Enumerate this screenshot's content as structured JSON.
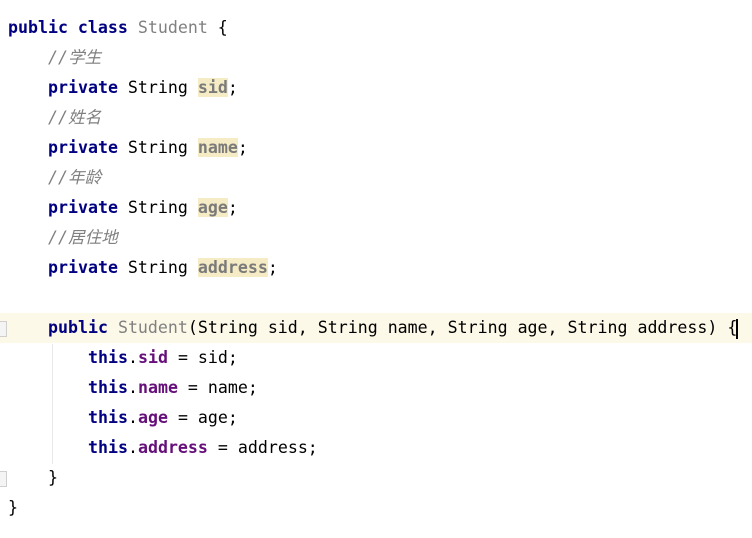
{
  "editor": {
    "language": "java",
    "current_line": 10,
    "colors": {
      "keyword": "#000080",
      "field": "#660e7a",
      "comment": "#808080",
      "unused_field_bg": "#f5ebc4",
      "current_line_bg": "#fdf9e8"
    },
    "lines": [
      {
        "indent": 0,
        "tokens": [
          {
            "t": "public class ",
            "c": "kw"
          },
          {
            "t": "Student",
            "c": "cls"
          },
          {
            "t": " {",
            "c": "plain"
          }
        ]
      },
      {
        "indent": 1,
        "tokens": [
          {
            "t": "//学生",
            "c": "cmt"
          }
        ]
      },
      {
        "indent": 1,
        "tokens": [
          {
            "t": "private",
            "c": "kw"
          },
          {
            "t": " String ",
            "c": "plain"
          },
          {
            "t": "sid",
            "c": "ufld"
          },
          {
            "t": ";",
            "c": "plain"
          }
        ]
      },
      {
        "indent": 1,
        "tokens": [
          {
            "t": "//姓名",
            "c": "cmt"
          }
        ]
      },
      {
        "indent": 1,
        "tokens": [
          {
            "t": "private",
            "c": "kw"
          },
          {
            "t": " String ",
            "c": "plain"
          },
          {
            "t": "name",
            "c": "ufld"
          },
          {
            "t": ";",
            "c": "plain"
          }
        ]
      },
      {
        "indent": 1,
        "tokens": [
          {
            "t": "//年龄",
            "c": "cmt"
          }
        ]
      },
      {
        "indent": 1,
        "tokens": [
          {
            "t": "private",
            "c": "kw"
          },
          {
            "t": " String ",
            "c": "plain"
          },
          {
            "t": "age",
            "c": "ufld"
          },
          {
            "t": ";",
            "c": "plain"
          }
        ]
      },
      {
        "indent": 1,
        "tokens": [
          {
            "t": "//居住地",
            "c": "cmt"
          }
        ]
      },
      {
        "indent": 1,
        "tokens": [
          {
            "t": "private",
            "c": "kw"
          },
          {
            "t": " String ",
            "c": "plain"
          },
          {
            "t": "address",
            "c": "ufld"
          },
          {
            "t": ";",
            "c": "plain"
          }
        ]
      },
      {
        "indent": 0,
        "tokens": []
      },
      {
        "indent": 1,
        "tokens": [
          {
            "t": "public",
            "c": "kw"
          },
          {
            "t": " ",
            "c": "plain"
          },
          {
            "t": "Student",
            "c": "cls"
          },
          {
            "t": "(String sid, String name, String age, String address) {",
            "c": "plain"
          }
        ]
      },
      {
        "indent": 2,
        "tokens": [
          {
            "t": "this",
            "c": "kw"
          },
          {
            "t": ".",
            "c": "plain"
          },
          {
            "t": "sid",
            "c": "fld"
          },
          {
            "t": " = sid;",
            "c": "plain"
          }
        ]
      },
      {
        "indent": 2,
        "tokens": [
          {
            "t": "this",
            "c": "kw"
          },
          {
            "t": ".",
            "c": "plain"
          },
          {
            "t": "name",
            "c": "fld"
          },
          {
            "t": " = name;",
            "c": "plain"
          }
        ]
      },
      {
        "indent": 2,
        "tokens": [
          {
            "t": "this",
            "c": "kw"
          },
          {
            "t": ".",
            "c": "plain"
          },
          {
            "t": "age",
            "c": "fld"
          },
          {
            "t": " = age;",
            "c": "plain"
          }
        ]
      },
      {
        "indent": 2,
        "tokens": [
          {
            "t": "this",
            "c": "kw"
          },
          {
            "t": ".",
            "c": "plain"
          },
          {
            "t": "address",
            "c": "fld"
          },
          {
            "t": " = address;",
            "c": "plain"
          }
        ]
      },
      {
        "indent": 1,
        "tokens": [
          {
            "t": "}",
            "c": "plain"
          }
        ]
      },
      {
        "indent": 0,
        "tokens": [
          {
            "t": "}",
            "c": "plain"
          }
        ]
      }
    ]
  }
}
